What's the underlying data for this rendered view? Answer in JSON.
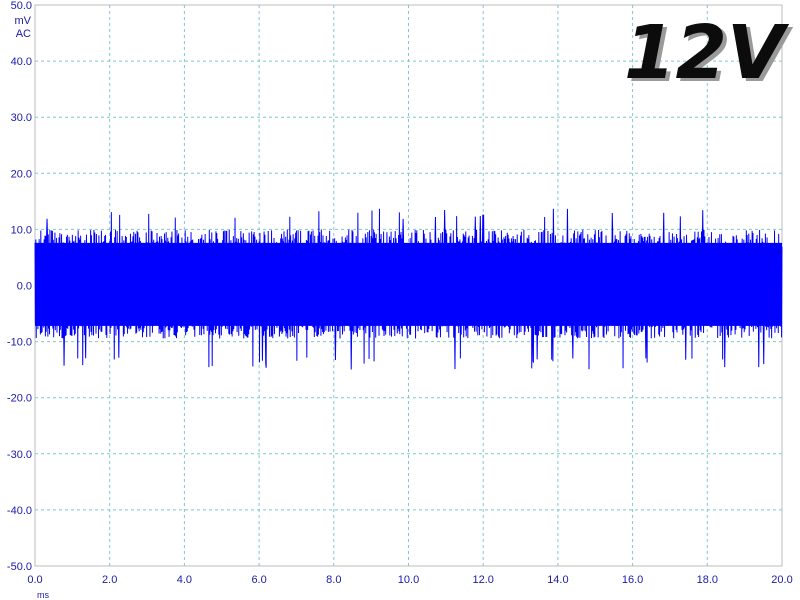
{
  "overlay_label": "12V",
  "chart_data": {
    "type": "line",
    "title": "",
    "y_unit": "mV",
    "coupling": "AC",
    "x_unit": "ms",
    "xlim": [
      0.0,
      20.0
    ],
    "ylim": [
      -50.0,
      50.0
    ],
    "x_ticks": [
      "0.0",
      "2.0",
      "4.0",
      "6.0",
      "8.0",
      "10.0",
      "12.0",
      "14.0",
      "16.0",
      "18.0",
      "20.0"
    ],
    "y_ticks": [
      "50.0",
      "40.0",
      "30.0",
      "20.0",
      "10.0",
      "0.0",
      "-10.0",
      "-20.0",
      "-30.0",
      "-40.0",
      "-50.0"
    ],
    "grid": true,
    "series": [
      {
        "trace_color": "#0000ff",
        "noise_band": {
          "center": 0.0,
          "typical_peak_to_peak": [
            -9.0,
            9.5
          ],
          "max_peak": 13.8,
          "min_peak": -15.0
        }
      }
    ]
  }
}
